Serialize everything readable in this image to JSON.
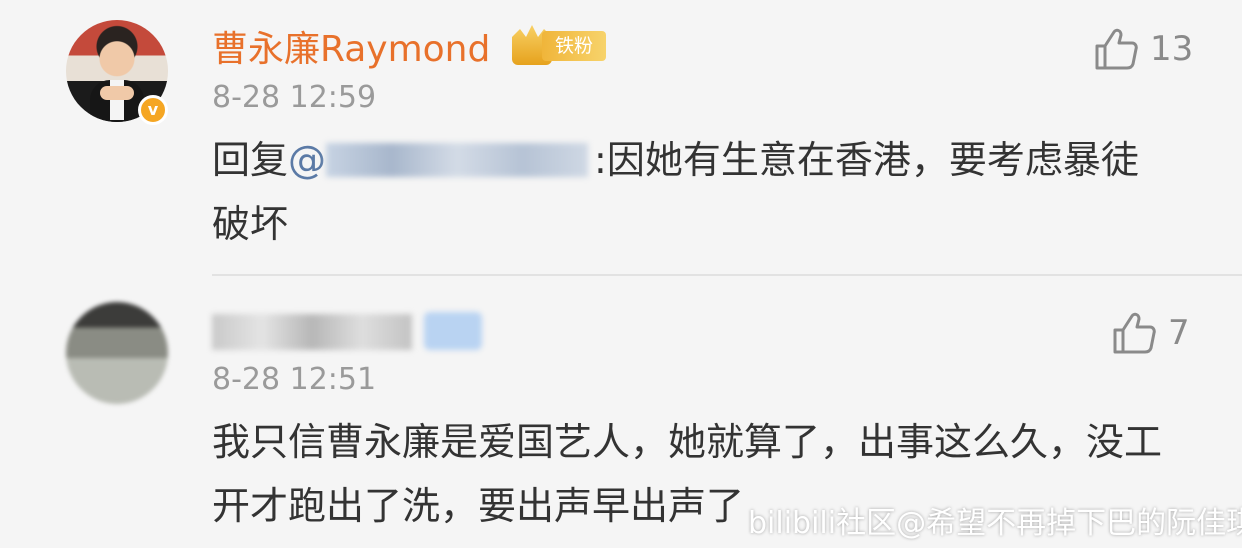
{
  "comments": [
    {
      "username": "曹永廉Raymond",
      "badge": "铁粉",
      "time": "8-28 12:59",
      "reply_prefix": "回复",
      "mention_at": "@",
      "text_after_mention": ":因她有生意在香港，要考虑暴徒破坏",
      "likes": "13"
    },
    {
      "username": "",
      "time": "8-28 12:51",
      "text": "我只信曹永廉是爱国艺人，她就算了，出事这么久，没工开才跑出了洗，要出声早出声了",
      "likes": "7"
    }
  ],
  "watermark": "bilibili社区@希望不再掉下巴的阮佳琪",
  "colors": {
    "username": "#e8712b",
    "mention": "#5b7aa6",
    "verify": "#f5a623"
  },
  "icons": {
    "like": "thumbs-up-icon",
    "verify": "verified-v-icon",
    "badge": "crown-icon"
  }
}
